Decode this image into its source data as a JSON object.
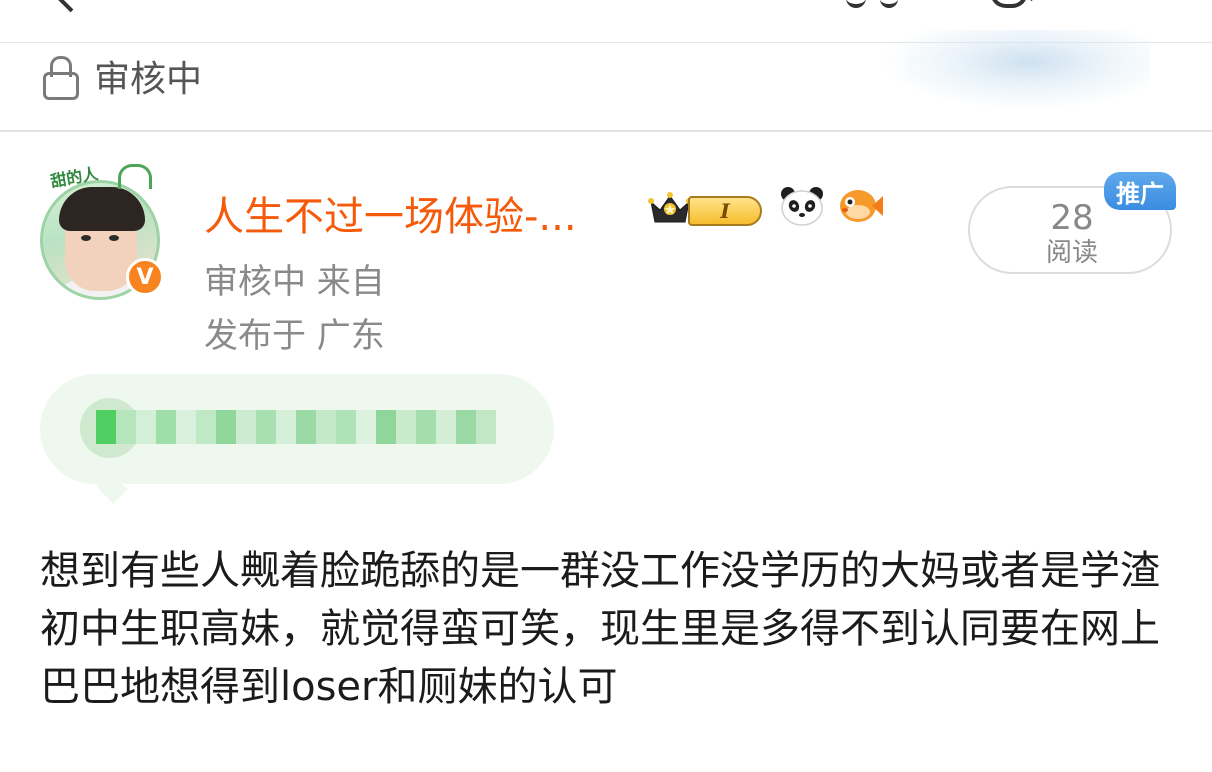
{
  "status": {
    "label": "审核中"
  },
  "post": {
    "author": "人生不过一场体验-...",
    "level_badge": "I",
    "meta_line1": "审核中 来自",
    "meta_line2": "发布于 广东",
    "read_count": "28",
    "read_label": "阅读",
    "promo_tag": "推广",
    "verified_mark": "V",
    "avatar_label": "甜的人",
    "content": "想到有些人觍着脸跪舔的是一群没工作没学历的大妈或者是学渣初中生职高妹，就觉得蛮可笑，现生里是多得不到认同要在网上巴巴地想得到loser和厕妹的认可"
  },
  "icons": {
    "lock": "lock-icon",
    "crown": "crown-icon",
    "panda": "panda-icon",
    "fish": "pufferfish-icon"
  },
  "colors": {
    "username": "#f55a0b",
    "verified": "#f7841e",
    "promo": "#3a8de0"
  }
}
